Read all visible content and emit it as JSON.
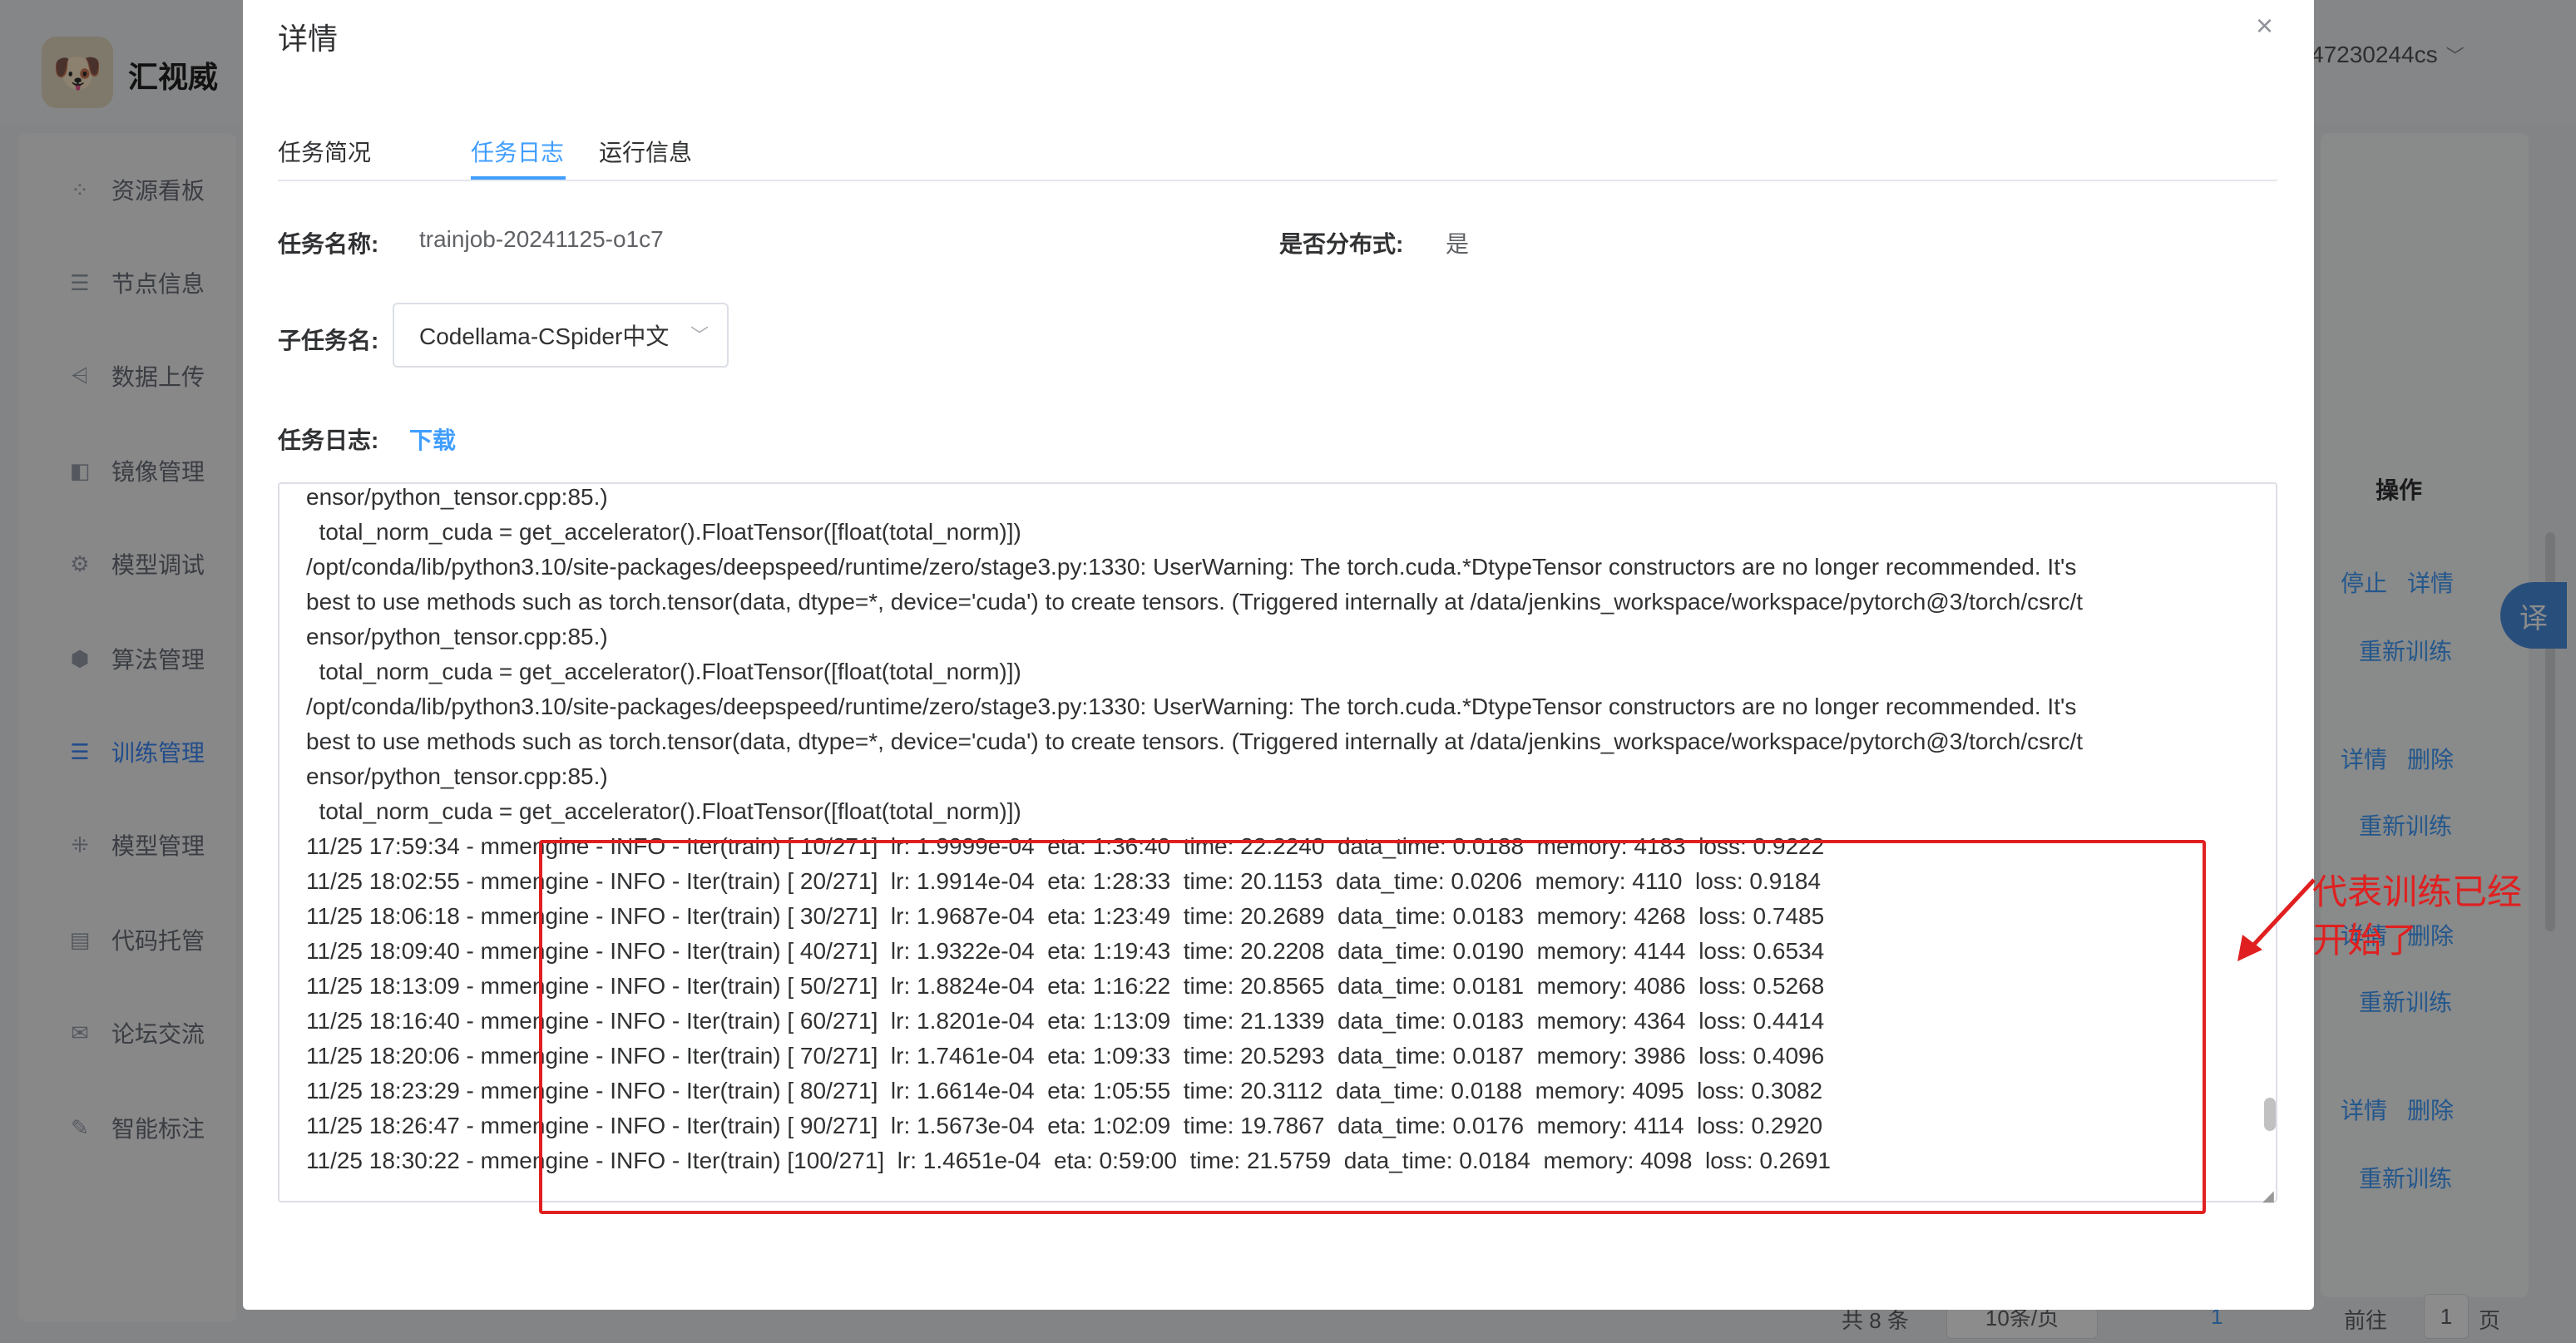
{
  "app": {
    "brand": "汇视威",
    "user": "47230244cs",
    "sidebar": [
      {
        "icon": "dashboard-icon",
        "glyph": "⁘",
        "label": "资源看板"
      },
      {
        "icon": "sliders-icon",
        "glyph": "☰",
        "label": "节点信息"
      },
      {
        "icon": "chart-icon",
        "glyph": "⩤",
        "label": "数据上传"
      },
      {
        "icon": "image-icon",
        "glyph": "◧",
        "label": "镜像管理"
      },
      {
        "icon": "debug-icon",
        "glyph": "⚙",
        "label": "模型调试"
      },
      {
        "icon": "algorithm-icon",
        "glyph": "⬢",
        "label": "算法管理"
      },
      {
        "icon": "training-icon",
        "glyph": "☰",
        "label": "训练管理"
      },
      {
        "icon": "model-icon",
        "glyph": "⁜",
        "label": "模型管理"
      },
      {
        "icon": "code-icon",
        "glyph": "▤",
        "label": "代码托管"
      },
      {
        "icon": "forum-icon",
        "glyph": "✉",
        "label": "论坛交流"
      },
      {
        "icon": "label-icon",
        "glyph": "✎",
        "label": "智能标注"
      }
    ],
    "table_ops": {
      "header": "操作",
      "stop": "停止",
      "detail": "详情",
      "delete": "删除",
      "retrain": "重新训练"
    },
    "pager": {
      "total": "共 8 条",
      "page_size": "10条/页",
      "current": "1",
      "goto_label": "前往",
      "goto_value": "1",
      "page_unit": "页"
    },
    "translate": "译"
  },
  "modal": {
    "title": "详情",
    "close": "×",
    "tabs": [
      "任务简况",
      "任务日志",
      "运行信息"
    ],
    "task_name_label": "任务名称:",
    "task_name": "trainjob-20241125-o1c7",
    "distributed_label": "是否分布式:",
    "distributed": "是",
    "subtask_label": "子任务名:",
    "subtask": "Codellama-CSpider中文",
    "log_label": "任务日志:",
    "download": "下载",
    "log_lines": [
      "ensor/python_tensor.cpp:85.)",
      "  total_norm_cuda = get_accelerator().FloatTensor([float(total_norm)])",
      "/opt/conda/lib/python3.10/site-packages/deepspeed/runtime/zero/stage3.py:1330: UserWarning: The torch.cuda.*DtypeTensor constructors are no longer recommended. It's",
      "best to use methods such as torch.tensor(data, dtype=*, device='cuda') to create tensors. (Triggered internally at /data/jenkins_workspace/workspace/pytorch@3/torch/csrc/t",
      "ensor/python_tensor.cpp:85.)",
      "  total_norm_cuda = get_accelerator().FloatTensor([float(total_norm)])",
      "/opt/conda/lib/python3.10/site-packages/deepspeed/runtime/zero/stage3.py:1330: UserWarning: The torch.cuda.*DtypeTensor constructors are no longer recommended. It's",
      "best to use methods such as torch.tensor(data, dtype=*, device='cuda') to create tensors. (Triggered internally at /data/jenkins_workspace/workspace/pytorch@3/torch/csrc/t",
      "ensor/python_tensor.cpp:85.)",
      "  total_norm_cuda = get_accelerator().FloatTensor([float(total_norm)])",
      "11/25 17:59:34 - mmengine - INFO - Iter(train) [ 10/271]  lr: 1.9999e-04  eta: 1:36:40  time: 22.2240  data_time: 0.0188  memory: 4183  loss: 0.9222",
      "11/25 18:02:55 - mmengine - INFO - Iter(train) [ 20/271]  lr: 1.9914e-04  eta: 1:28:33  time: 20.1153  data_time: 0.0206  memory: 4110  loss: 0.9184",
      "11/25 18:06:18 - mmengine - INFO - Iter(train) [ 30/271]  lr: 1.9687e-04  eta: 1:23:49  time: 20.2689  data_time: 0.0183  memory: 4268  loss: 0.7485",
      "11/25 18:09:40 - mmengine - INFO - Iter(train) [ 40/271]  lr: 1.9322e-04  eta: 1:19:43  time: 20.2208  data_time: 0.0190  memory: 4144  loss: 0.6534",
      "11/25 18:13:09 - mmengine - INFO - Iter(train) [ 50/271]  lr: 1.8824e-04  eta: 1:16:22  time: 20.8565  data_time: 0.0181  memory: 4086  loss: 0.5268",
      "11/25 18:16:40 - mmengine - INFO - Iter(train) [ 60/271]  lr: 1.8201e-04  eta: 1:13:09  time: 21.1339  data_time: 0.0183  memory: 4364  loss: 0.4414",
      "11/25 18:20:06 - mmengine - INFO - Iter(train) [ 70/271]  lr: 1.7461e-04  eta: 1:09:33  time: 20.5293  data_time: 0.0187  memory: 3986  loss: 0.4096",
      "11/25 18:23:29 - mmengine - INFO - Iter(train) [ 80/271]  lr: 1.6614e-04  eta: 1:05:55  time: 20.3112  data_time: 0.0188  memory: 4095  loss: 0.3082",
      "11/25 18:26:47 - mmengine - INFO - Iter(train) [ 90/271]  lr: 1.5673e-04  eta: 1:02:09  time: 19.7867  data_time: 0.0176  memory: 4114  loss: 0.2920",
      "11/25 18:30:22 - mmengine - INFO - Iter(train) [100/271]  lr: 1.4651e-04  eta: 0:59:00  time: 21.5759  data_time: 0.0184  memory: 4098  loss: 0.2691"
    ]
  },
  "annotation": {
    "text": "代表训练已经开始了",
    "color": "#e02020"
  }
}
